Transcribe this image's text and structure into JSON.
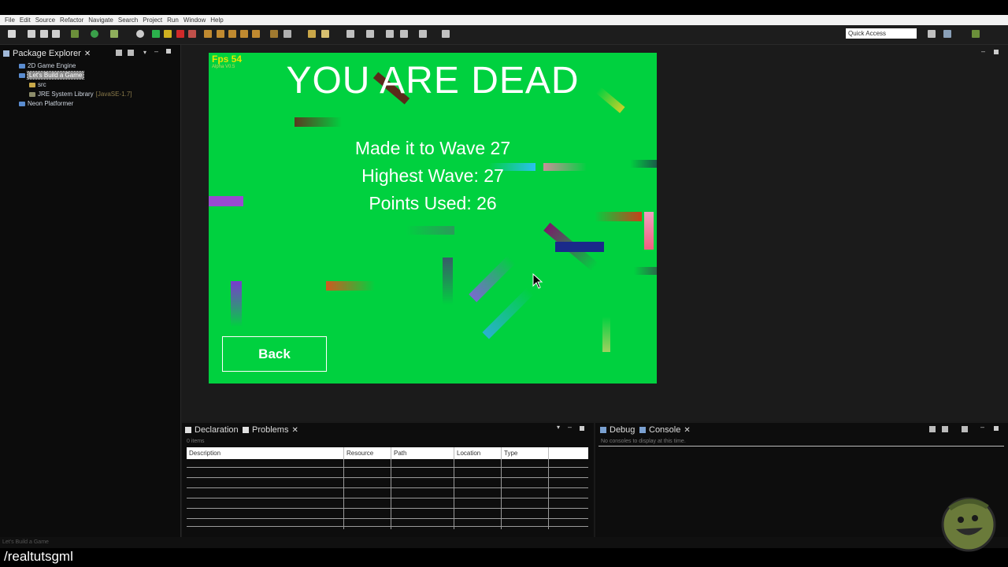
{
  "menu": [
    "File",
    "Edit",
    "Source",
    "Refactor",
    "Navigate",
    "Search",
    "Project",
    "Run",
    "Window",
    "Help"
  ],
  "quick_access": "Quick Access",
  "left_panel": {
    "tab_title": "Package Explorer",
    "tree": [
      {
        "label": "2D Game Engine",
        "selected": false
      },
      {
        "label": "Let's Build a Game",
        "selected": true
      },
      {
        "label": "src",
        "selected": false
      },
      {
        "label": "JRE System Library",
        "suffix": "[JavaSE-1.7]",
        "selected": false
      },
      {
        "label": "Neon Platformer",
        "selected": false
      }
    ]
  },
  "game": {
    "fps": "Fps 54",
    "version": "Alpha V0.5",
    "title": "YOU ARE DEAD",
    "wave_line": "Made it to Wave 27",
    "highest_line": "Highest Wave: 27",
    "points_line": "Points Used: 26",
    "back_label": "Back",
    "background": "#00d13f"
  },
  "problems_panel": {
    "tabs": [
      "Declaration",
      "Problems"
    ],
    "items_count": "0 items",
    "columns": [
      "Description",
      "Resource",
      "Path",
      "Location",
      "Type"
    ]
  },
  "console_panel": {
    "tabs": [
      "Debug",
      "Console"
    ],
    "message": "No consoles to display at this time."
  },
  "status_bar": "Let's Build a Game",
  "watermark": "/realtutsgml"
}
